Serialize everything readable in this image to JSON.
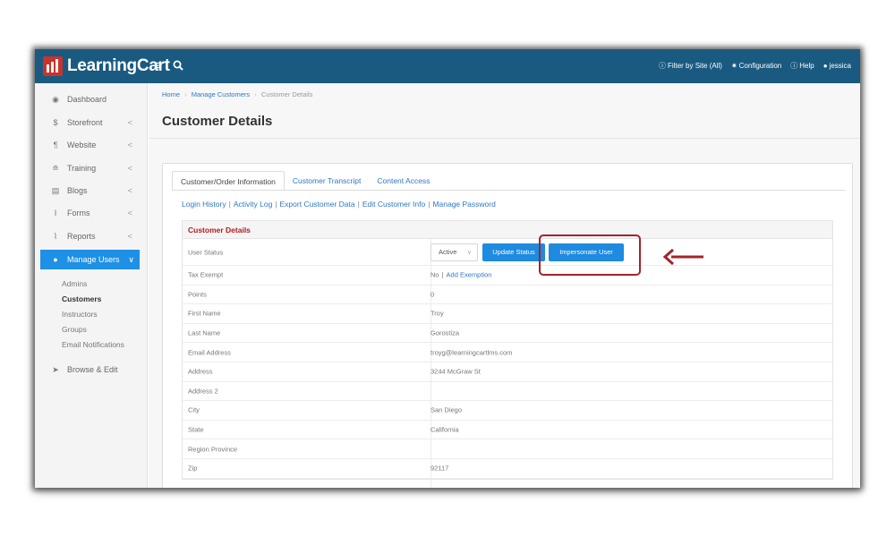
{
  "app": {
    "brand": "LearningCart",
    "colors": {
      "topbar": "#1a5a80",
      "accent": "#1e8ae0",
      "brand_red": "#c8332b",
      "highlight": "#a3232a"
    },
    "icons": {
      "menu": "hamburger-menu-icon",
      "search": "search-icon"
    }
  },
  "topbar": {
    "filter_label": "Filter by Site (All)",
    "config_label": "Configuration",
    "help_label": "Help",
    "user_label": "jessica"
  },
  "sidebar": {
    "items": [
      {
        "label": "Dashboard",
        "icon": "dashboard-icon"
      },
      {
        "label": "Storefront",
        "icon": "dollar-icon",
        "chevron": "<"
      },
      {
        "label": "Website",
        "icon": "paragraph-icon",
        "chevron": "<"
      },
      {
        "label": "Training",
        "icon": "graduation-cap-icon",
        "chevron": "<"
      },
      {
        "label": "Blogs",
        "icon": "blog-icon",
        "chevron": "<"
      },
      {
        "label": "Forms",
        "icon": "cursor-text-icon",
        "chevron": "<"
      },
      {
        "label": "Reports",
        "icon": "line-chart-icon",
        "chevron": "<"
      },
      {
        "label": "Manage Users",
        "icon": "users-icon",
        "chevron": "∨"
      },
      {
        "label": "Browse & Edit",
        "icon": "pointer-icon"
      }
    ],
    "subitems": [
      {
        "label": "Admins"
      },
      {
        "label": "Customers"
      },
      {
        "label": "Instructors"
      },
      {
        "label": "Groups"
      },
      {
        "label": "Email Notifications"
      }
    ]
  },
  "main": {
    "breadcrumb": {
      "home": "Home",
      "manage": "Manage Customers",
      "current": "Customer Details"
    },
    "page_title": "Customer Details",
    "tabs": [
      {
        "label": "Customer/Order Information"
      },
      {
        "label": "Customer Transcript"
      },
      {
        "label": "Content Access"
      }
    ],
    "links": [
      {
        "label": "Login History"
      },
      {
        "label": "Activity Log"
      },
      {
        "label": "Export Customer Data"
      },
      {
        "label": "Edit Customer Info"
      },
      {
        "label": "Manage Password"
      }
    ],
    "section_title": "Customer Details",
    "status": {
      "label": "User Status",
      "selected": "Active",
      "update_button": "Update Status",
      "impersonate_button": "Impersonate User"
    },
    "tax": {
      "label": "Tax Exempt",
      "value": "No",
      "link": "Add Exemption"
    },
    "rows": [
      {
        "label": "Points",
        "value": "0"
      },
      {
        "label": "First Name",
        "value": "Troy"
      },
      {
        "label": "Last Name",
        "value": "Gorostiza"
      },
      {
        "label": "Email Address",
        "value": "troyg@learningcartlms.com"
      },
      {
        "label": "Address",
        "value": "3244 McGraw St"
      },
      {
        "label": "Address 2",
        "value": ""
      },
      {
        "label": "City",
        "value": "San Diego"
      },
      {
        "label": "State",
        "value": "California"
      },
      {
        "label": "Region Province",
        "value": ""
      },
      {
        "label": "Zip",
        "value": "92117"
      }
    ]
  }
}
